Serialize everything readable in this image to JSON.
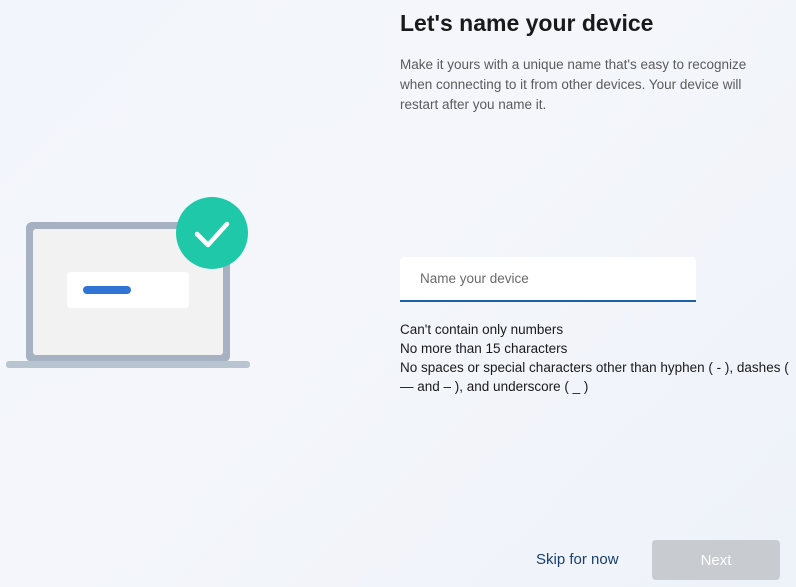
{
  "page": {
    "title": "Let's name your device",
    "description": "Make it yours with a unique name that's easy to recognize when connecting to it from other devices. Your device will restart after you name it."
  },
  "device_name": {
    "placeholder": "Name your device",
    "value": ""
  },
  "rules": [
    "Can't contain only numbers",
    "No more than 15 characters",
    "No spaces or special characters other than hyphen ( - ), dashes ( — and – ), and underscore ( _ )"
  ],
  "footer": {
    "skip_label": "Skip for now",
    "next_label": "Next",
    "next_enabled": false
  },
  "icons": {
    "illustration": "laptop-with-checkmark-icon",
    "check": "checkmark-icon"
  },
  "colors": {
    "accent": "#1d5fa8",
    "check_badge": "#1fc8a9",
    "laptop_frame": "#9aa9bb",
    "screen_bar": "#2f74d3",
    "next_disabled": "#c8cbcf"
  }
}
